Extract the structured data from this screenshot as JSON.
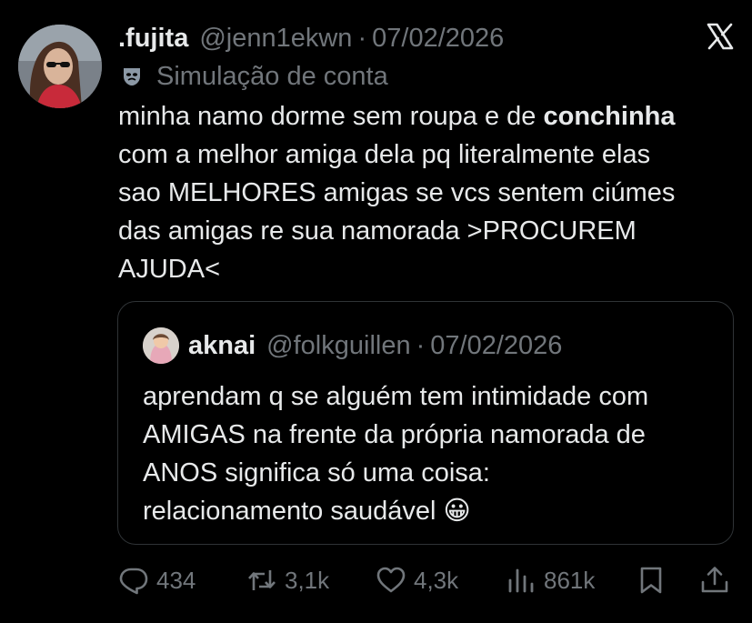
{
  "post": {
    "display_name": ".fujita",
    "handle": "@jenn1ekwn",
    "separator": "·",
    "date": "07/02/2026",
    "label": "Simulação de conta",
    "text_lines": [
      {
        "before": "minha namo dorme sem roupa e de ",
        "bold": "conchinha"
      },
      {
        "text": "com a melhor amiga dela pq literalmente elas"
      },
      {
        "text": "sao MELHORES amigas se vcs sentem ciúmes"
      },
      {
        "text": "das amigas re sua namorada >PROCUREM"
      },
      {
        "text": "AJUDA<"
      }
    ]
  },
  "quote": {
    "display_name": "aknai",
    "handle": "@folkguillen",
    "separator": "·",
    "date": "07/02/2026",
    "text_lines": [
      "aprendam q se alguém tem intimidade com",
      "AMIGAS na frente da própria namorada de",
      "ANOS significa só uma coisa:",
      "relacionamento saudável"
    ],
    "emoji": "😀"
  },
  "actions": {
    "replies": "434",
    "reposts": "3,1k",
    "likes": "4,3k",
    "views": "861k"
  },
  "icons": [
    "x-logo-icon",
    "mask-icon",
    "reply-icon",
    "repost-icon",
    "like-icon",
    "views-icon",
    "bookmark-icon",
    "share-icon"
  ],
  "colors": {
    "background": "#000000",
    "text": "#e7e9ea",
    "muted": "#71767b",
    "border": "#2f3336"
  }
}
